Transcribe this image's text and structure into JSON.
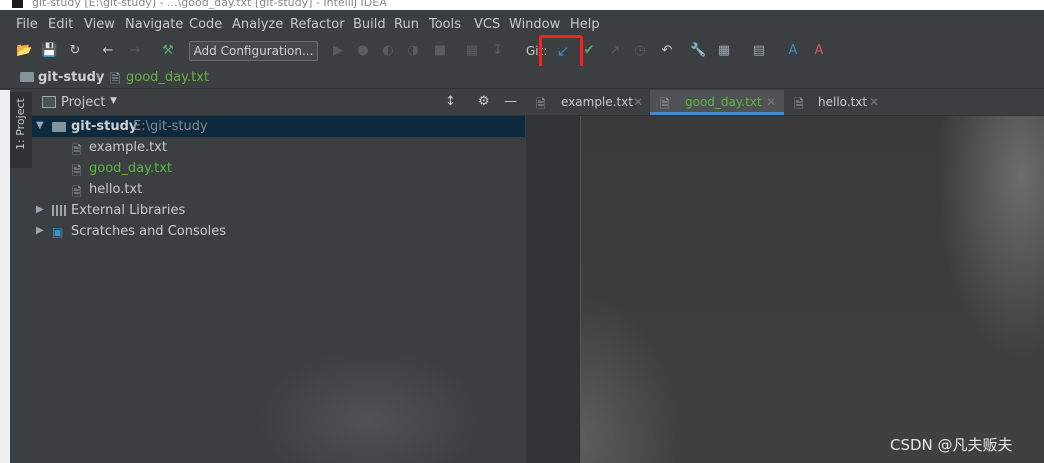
{
  "window": {
    "title": "git-study [E:\\git-study] - ...\\good_day.txt [git-study] - IntelliJ IDEA"
  },
  "menu": {
    "items": [
      "File",
      "Edit",
      "View",
      "Navigate",
      "Code",
      "Analyze",
      "Refactor",
      "Build",
      "Run",
      "Tools",
      "VCS",
      "Window",
      "Help"
    ]
  },
  "toolbar": {
    "add_configuration_label": "Add Configuration...",
    "git_label": "Git:",
    "update_project_icon": "update-arrow-icon",
    "commit_icon": "check-icon"
  },
  "breadcrumb": {
    "project": "git-study",
    "file": "good_day.txt"
  },
  "side_strip": {
    "project_tab": "1: Project"
  },
  "project_panel": {
    "title": "Project",
    "root": {
      "name": "git-study",
      "path": "E:\\git-study"
    },
    "files": [
      {
        "name": "example.txt"
      },
      {
        "name": "good_day.txt"
      },
      {
        "name": "hello.txt"
      }
    ],
    "external_libraries": "External Libraries",
    "scratches": "Scratches and Consoles"
  },
  "editor": {
    "tabs": [
      {
        "label": "example.txt"
      },
      {
        "label": "good_day.txt"
      },
      {
        "label": "hello.txt"
      }
    ]
  },
  "watermark": {
    "text": "CSDN @凡夫贩夫"
  },
  "colors": {
    "modified_file": "#62b543",
    "active_tab_underline": "#4a88c7",
    "highlight_box": "#ff2020",
    "git_update_arrow": "#3592c4",
    "git_commit_check": "#59a869",
    "translate_blue": "#3592c4",
    "translate_red": "#e05555"
  }
}
